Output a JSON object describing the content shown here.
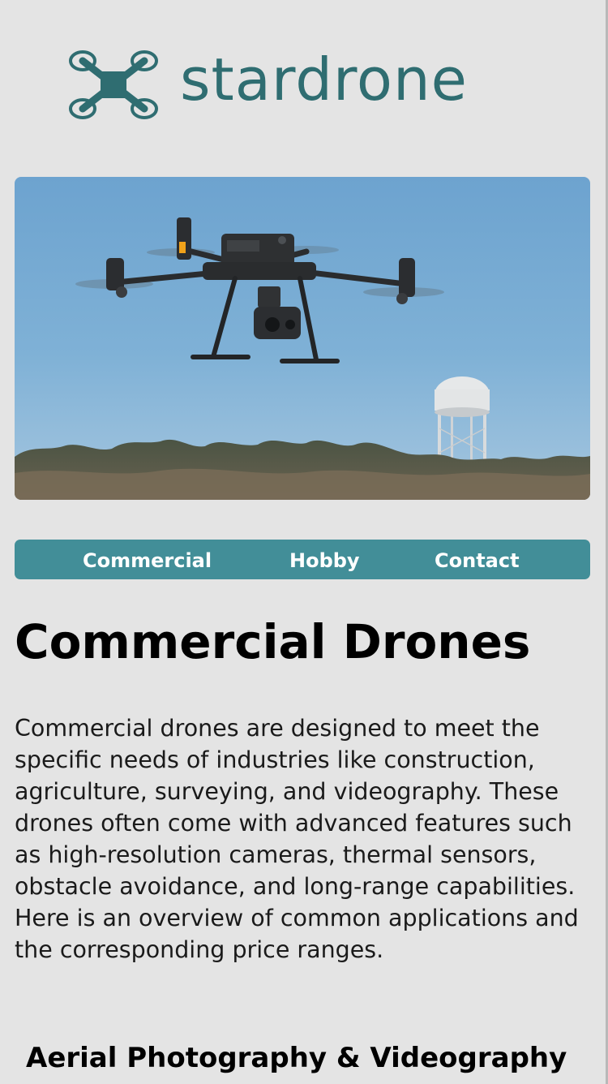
{
  "brand": {
    "name": "stardrone",
    "color": "#2f6d71"
  },
  "hero": {
    "icon": "drone-photo"
  },
  "nav": {
    "background": "#428e98",
    "items": [
      {
        "label": "Commercial"
      },
      {
        "label": "Hobby"
      },
      {
        "label": "Contact"
      }
    ]
  },
  "page": {
    "title": "Commercial Drones",
    "intro": "Commercial drones are designed to meet the specific needs of industries like construction, agriculture, surveying, and videography. These drones often come with advanced features such as high-resolution cameras, thermal sensors, obstacle avoidance, and long-range capabilities. Here is an overview of common applications and the corresponding price ranges."
  },
  "sections": [
    {
      "title": "Aerial Photography & Videography"
    }
  ]
}
